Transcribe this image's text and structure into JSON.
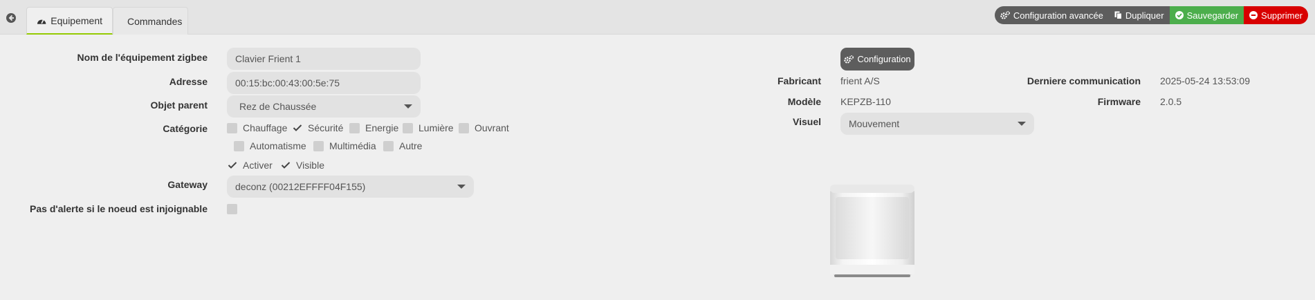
{
  "tabs": [
    {
      "label": "Equipement",
      "icon": "tachometer-icon"
    },
    {
      "label": "Commandes",
      "icon": "list-icon"
    }
  ],
  "actions": {
    "advanced_config": "Configuration avancée",
    "duplicate": "Dupliquer",
    "save": "Sauvegarder",
    "delete": "Supprimer"
  },
  "colors": {
    "accent": "#94ca02",
    "save": "#4cae4c",
    "delete": "#d80000",
    "neutral_button": "#5d5d5d"
  },
  "form": {
    "name_label": "Nom de l'équipement zigbee",
    "name_value": "Clavier Frient 1",
    "address_label": "Adresse",
    "address_value": "00:15:bc:00:43:00:5e:75",
    "parent_label": "Objet parent",
    "parent_value": "Rez de Chaussée",
    "category_label": "Catégorie",
    "categories": [
      {
        "label": "Chauffage",
        "checked": false
      },
      {
        "label": "Sécurité",
        "checked": true
      },
      {
        "label": "Energie",
        "checked": false
      },
      {
        "label": "Lumière",
        "checked": false
      },
      {
        "label": "Ouvrant",
        "checked": false
      },
      {
        "label": "Automatisme",
        "checked": false
      },
      {
        "label": "Multimédia",
        "checked": false
      },
      {
        "label": "Autre",
        "checked": false
      }
    ],
    "activate_label": "Activer",
    "activate_checked": true,
    "visible_label": "Visible",
    "visible_checked": true,
    "gateway_label": "Gateway",
    "gateway_value": "deconz (00212EFFFF04F155)",
    "no_alert_label": "Pas d'alerte si le noeud est injoignable",
    "no_alert_checked": false
  },
  "info": {
    "config_button": "Configuration",
    "manufacturer_label": "Fabricant",
    "manufacturer_value": "frient A/S",
    "model_label": "Modèle",
    "model_value": "KEPZB-110",
    "visual_label": "Visuel",
    "visual_value": "Mouvement",
    "last_comm_label": "Derniere communication",
    "last_comm_value": "2025-05-24 13:53:09",
    "firmware_label": "Firmware",
    "firmware_value": "2.0.5"
  }
}
